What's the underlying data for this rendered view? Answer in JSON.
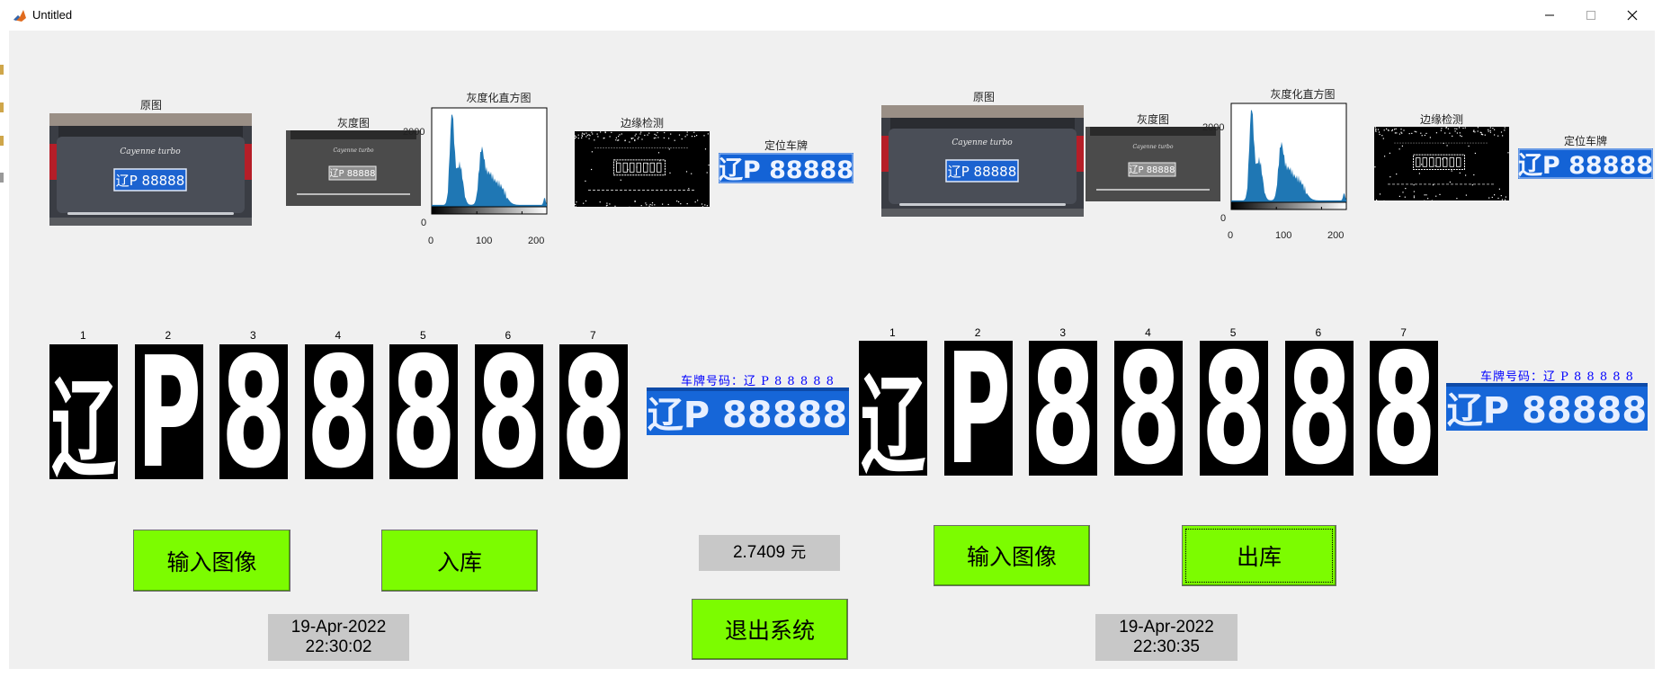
{
  "window": {
    "title": "Untitled",
    "controls": [
      "minimize-icon",
      "maximize-icon",
      "close-icon"
    ]
  },
  "panels": [
    {
      "labels": {
        "original": "原图",
        "gray": "灰度图",
        "histogram": "灰度化直方图",
        "edge": "边缘检测",
        "locate": "定位车牌"
      },
      "car_badge": "Cayenne turbo",
      "plate_text": "辽P 88888",
      "small_plate_text": "辽P 88888",
      "hist_yticks": [
        "2000",
        "0"
      ],
      "hist_xticks": [
        "0",
        "100",
        "200"
      ],
      "char_indices": [
        "1",
        "2",
        "3",
        "4",
        "5",
        "6",
        "7"
      ],
      "char_glyphs": [
        "辽",
        "P",
        "8",
        "8",
        "8",
        "8",
        "8"
      ],
      "plate_label": "车牌号码：辽 P 8 8 8 8 8",
      "result_plate": "辽P 88888",
      "input_button": "输入图像",
      "action_button": "入库",
      "datetime": {
        "date": "19-Apr-2022",
        "time": "22:30:02"
      }
    },
    {
      "labels": {
        "original": "原图",
        "gray": "灰度图",
        "histogram": "灰度化直方图",
        "edge": "边缘检测",
        "locate": "定位车牌"
      },
      "car_badge": "Cayenne turbo",
      "plate_text": "辽P 88888",
      "small_plate_text": "辽P 88888",
      "hist_yticks": [
        "2000",
        "0"
      ],
      "hist_xticks": [
        "0",
        "100",
        "200"
      ],
      "char_indices": [
        "1",
        "2",
        "3",
        "4",
        "5",
        "6",
        "7"
      ],
      "char_glyphs": [
        "辽",
        "P",
        "8",
        "8",
        "8",
        "8",
        "8"
      ],
      "plate_label": "车牌号码：辽 P 8 8 8 8 8",
      "result_plate": "辽P 88888",
      "input_button": "输入图像",
      "action_button": "出库",
      "datetime": {
        "date": "19-Apr-2022",
        "time": "22:30:35"
      }
    }
  ],
  "fee": {
    "value": "2.7409",
    "unit": "元"
  },
  "exit_button": "退出系统",
  "colors": {
    "button_green": "#7cfc00",
    "plate_blue": "#1463d6",
    "histogram_blue": "#1f77b4",
    "label_blue": "#0000ff",
    "textbox_gray": "#c8c8c8"
  }
}
